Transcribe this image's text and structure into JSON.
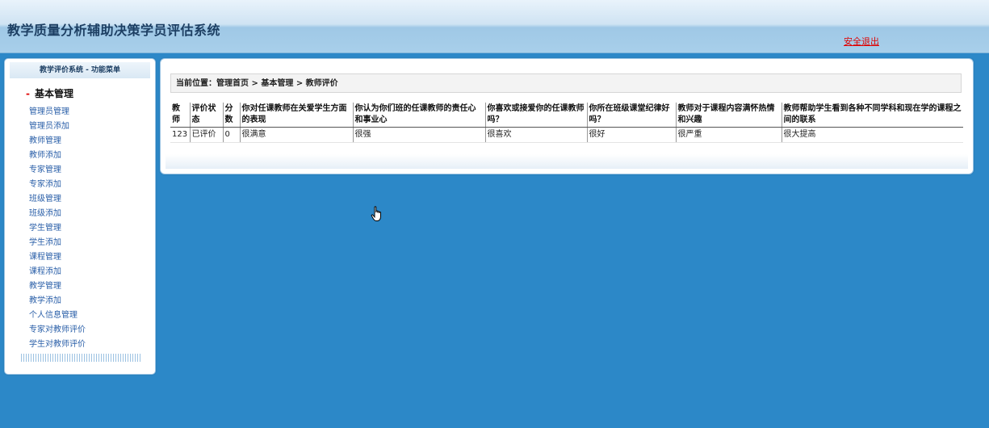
{
  "app": {
    "title": "教学质量分析辅助决策学员评估系统",
    "logout_label": "安全退出"
  },
  "sidebar": {
    "header": "教学评价系统 - 功能菜单",
    "section_dash": "-",
    "section_title": "基本管理",
    "items": [
      {
        "label": "管理员管理"
      },
      {
        "label": "管理员添加"
      },
      {
        "label": "教师管理"
      },
      {
        "label": "教师添加"
      },
      {
        "label": "专家管理"
      },
      {
        "label": "专家添加"
      },
      {
        "label": "班级管理"
      },
      {
        "label": "班级添加"
      },
      {
        "label": "学生管理"
      },
      {
        "label": "学生添加"
      },
      {
        "label": "课程管理"
      },
      {
        "label": "课程添加"
      },
      {
        "label": "教学管理"
      },
      {
        "label": "教学添加"
      },
      {
        "label": "个人信息管理"
      },
      {
        "label": "专家对教师评价"
      },
      {
        "label": "学生对教师评价"
      }
    ]
  },
  "main": {
    "breadcrumb": "当前位置：管理首页 > 基本管理 > 教师评价",
    "table": {
      "headers": [
        "教师",
        "评价状态",
        "分数",
        "你对任课教师在关爱学生方面的表现",
        "你认为你们班的任课教师的责任心和事业心",
        "你喜欢或接爱你的任课教师吗？",
        "你所在班级课堂纪律好吗？",
        "教师对于课程内容满怀热情和兴趣",
        "教师帮助学生看到各种不同学科和现在学的课程之间的联系"
      ],
      "rows": [
        [
          "123",
          "已评价",
          "0",
          "很满意",
          "很强",
          "很喜欢",
          "很好",
          "很严重",
          "很大提高"
        ]
      ]
    }
  },
  "colors": {
    "background": "#2c88c8",
    "title": "#1d3f63",
    "logout": "#e00000",
    "menu_link": "#2a5fa8"
  },
  "icons": {
    "cursor": "hand-pointer-icon"
  }
}
